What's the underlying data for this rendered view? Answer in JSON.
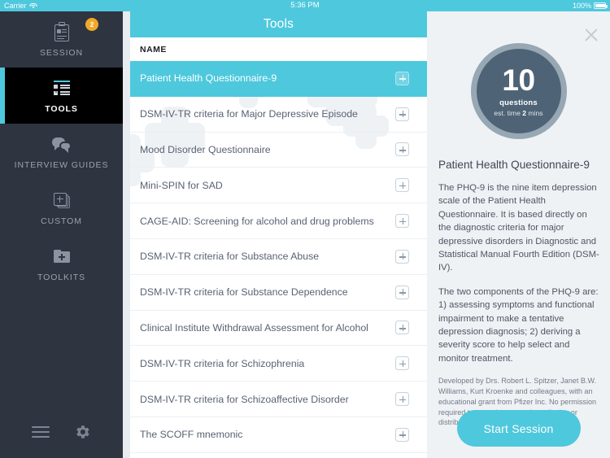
{
  "statusbar": {
    "carrier": "Carrier",
    "time": "5:36 PM",
    "battery": "100%"
  },
  "sidebar": {
    "items": [
      {
        "label": "SESSION",
        "icon": "clipboard-icon",
        "badge": "2",
        "active": false
      },
      {
        "label": "TOOLS",
        "icon": "checklist-icon",
        "badge": "",
        "active": true
      },
      {
        "label": "INTERVIEW GUIDES",
        "icon": "chat-bubbles-icon",
        "badge": "",
        "active": false
      },
      {
        "label": "CUSTOM",
        "icon": "add-card-icon",
        "badge": "",
        "active": false
      },
      {
        "label": "TOOLKITS",
        "icon": "add-folder-icon",
        "badge": "",
        "active": false
      }
    ],
    "bottom": {
      "menu_icon": "hamburger-icon",
      "settings_icon": "gear-icon"
    }
  },
  "list": {
    "header_title": "Tools",
    "column_header": "NAME",
    "add_icon": "plus-icon",
    "rows": [
      {
        "name": "Patient Health Questionnaire-9",
        "selected": true
      },
      {
        "name": "DSM-IV-TR criteria for Major Depressive Episode",
        "selected": false
      },
      {
        "name": "Mood Disorder Questionnaire",
        "selected": false
      },
      {
        "name": "Mini-SPIN for SAD",
        "selected": false
      },
      {
        "name": "CAGE-AID: Screening for alcohol and drug problems",
        "selected": false
      },
      {
        "name": "DSM-IV-TR criteria for Substance Abuse",
        "selected": false
      },
      {
        "name": "DSM-IV-TR criteria for Substance Dependence",
        "selected": false
      },
      {
        "name": "Clinical Institute Withdrawal Assessment for Alcohol",
        "selected": false
      },
      {
        "name": "DSM-IV-TR criteria for Schizophrenia",
        "selected": false
      },
      {
        "name": "DSM-IV-TR criteria for Schizoaffective Disorder",
        "selected": false
      },
      {
        "name": "The SCOFF mnemonic",
        "selected": false
      }
    ]
  },
  "detail": {
    "close_icon": "close-icon",
    "question_count": "10",
    "questions_label": "questions",
    "est_prefix": "est. time ",
    "est_value": "2",
    "est_suffix": " mins",
    "title": "Patient Health Questionnaire-9",
    "paragraph1": "The PHQ-9 is the nine item depression scale of the Patient Health Questionnaire. It is based directly on the diagnostic criteria for major depressive disorders in Diagnostic and Statistical Manual Fourth Edition (DSM-IV).",
    "paragraph2": "The two components of the PHQ-9 are: 1) assessing symptoms and functional impairment to make a tentative depression diagnosis; 2) deriving a severity score to help select and monitor treatment.",
    "attribution": "Developed by Drs. Robert L. Spitzer, Janet B.W. Williams, Kurt Kroenke and colleagues, with an educational grant from Pfizer Inc. No permission required to reproduce, translate, display or distribute.",
    "start_button": "Start Session"
  },
  "colors": {
    "accent": "#4ec8dd",
    "sidebar_bg": "#2e3440",
    "sidebar_active_bg": "#000000",
    "badge": "#f0a92b",
    "circle_fill": "#4e6476",
    "circle_ring": "#97a8b4",
    "panel_bg": "#eff2f5"
  }
}
